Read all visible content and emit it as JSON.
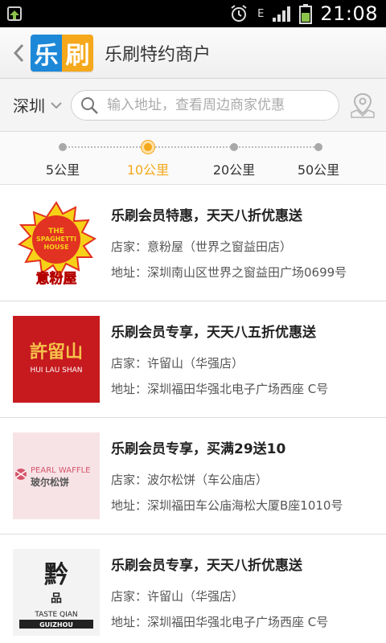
{
  "status_bar": {
    "time": "21:08",
    "network_label": "E"
  },
  "header": {
    "back_icon": "chevron-left-icon",
    "logo_char_1": "乐",
    "logo_char_2": "刷",
    "title": "乐刷特约商户",
    "colors": {
      "logo_blue": "#1e88d8",
      "logo_orange": "#f5a81b"
    }
  },
  "search": {
    "city": "深圳",
    "placeholder": "输入地址，查看周边商家优惠"
  },
  "distance": {
    "options": [
      "5公里",
      "10公里",
      "20公里",
      "50公里"
    ],
    "selected": "10公里",
    "accent": "#f5a81b"
  },
  "merchants": [
    {
      "title": "乐刷会员特惠，天天八折优惠送",
      "shop": "店家：意粉屋（世界之窗益田店）",
      "address": "地址：深圳南山区世界之窗益田广场0699号",
      "logo_text_1": "THE SPAGHETTI HOUSE",
      "logo_text_2": "意粉屋"
    },
    {
      "title": "乐刷会员专享，天天八五折优惠送",
      "shop": "店家：许留山（华强店）",
      "address": "地址：深圳福田华强北电子广场西座 C号",
      "logo_text_1": "許留山",
      "logo_text_2": "HUI LAU SHAN"
    },
    {
      "title": "乐刷会员专享，买满29送10",
      "shop": "店家：波尔松饼（车公庙店）",
      "address": "地址：深圳福田车公庙海松大厦B座1010号",
      "logo_text_1": "PEARL WAFFLE",
      "logo_text_2": "玻尔松饼"
    },
    {
      "title": "乐刷会员专享，天天八折优惠送",
      "shop": "店家：许留山（华强店）",
      "address": "地址：深圳福田华强北电子广场西座 C号",
      "logo_text_1": "TASTE QIAN",
      "logo_text_2": "GUIZHOU"
    }
  ]
}
